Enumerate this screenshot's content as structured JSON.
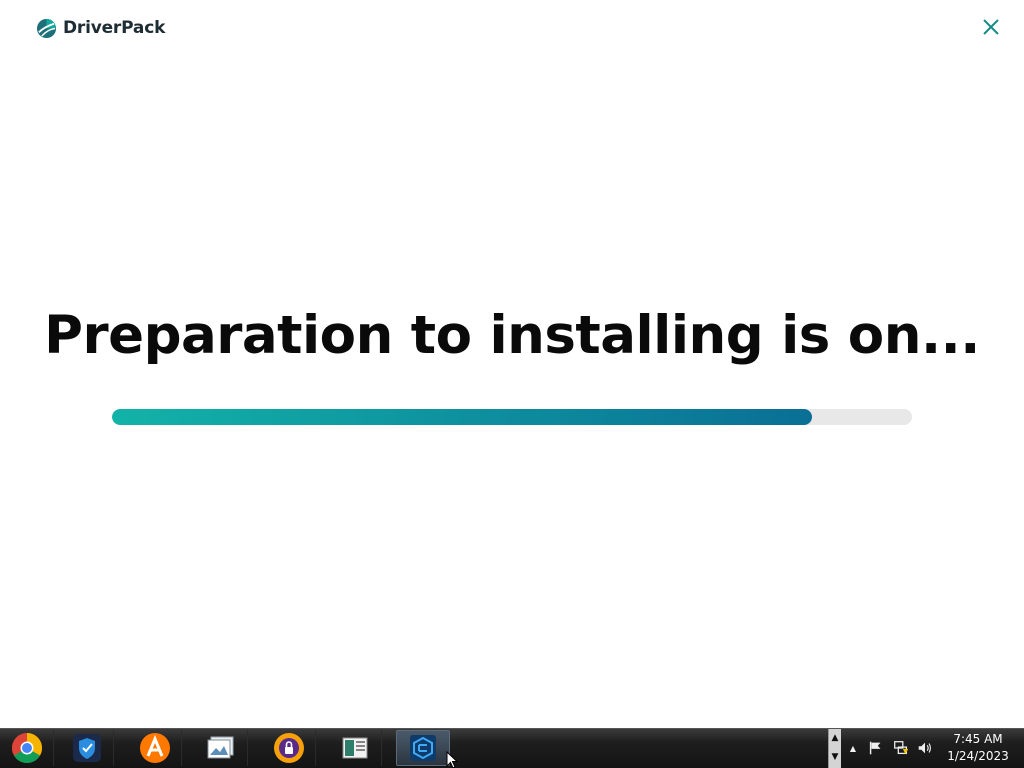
{
  "app": {
    "brand": "DriverPack",
    "headline": "Preparation to installing is on...",
    "progress_fraction": 0.875,
    "colors": {
      "accent_start": "#12b3a8",
      "accent_end": "#0a6f95",
      "track": "#e8e8e8",
      "close": "#1a8c86"
    }
  },
  "taskbar": {
    "apps": [
      {
        "name": "chrome-icon"
      },
      {
        "name": "shield-app-icon"
      },
      {
        "name": "avast-icon"
      },
      {
        "name": "photo-viewer-icon"
      },
      {
        "name": "lock-app-icon"
      },
      {
        "name": "document-app-icon"
      },
      {
        "name": "driverpack-app-icon"
      }
    ],
    "tray": {
      "up_arrow": "▲",
      "down_arrow": "▼",
      "expand": "▲",
      "time": "7:45 AM",
      "date": "1/24/2023"
    }
  }
}
